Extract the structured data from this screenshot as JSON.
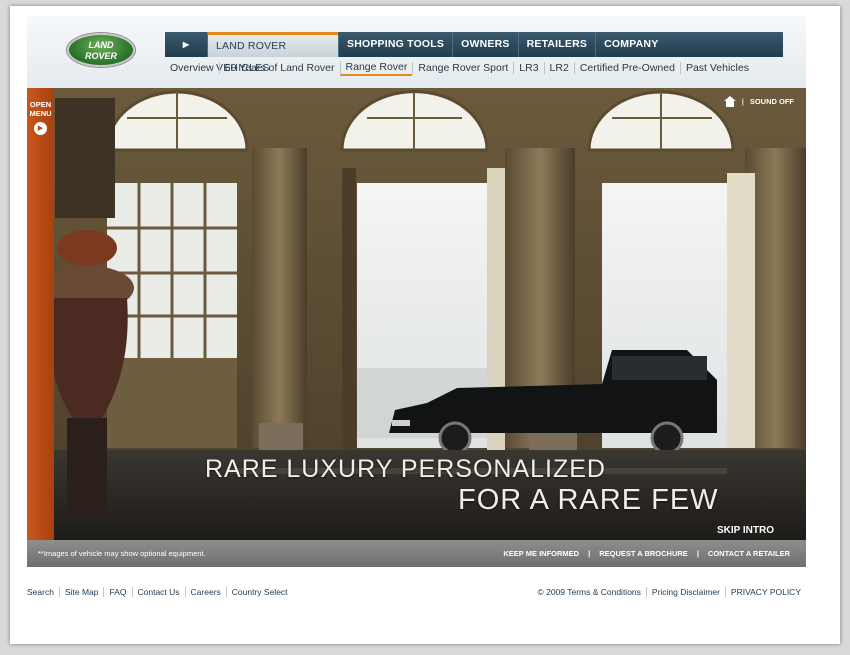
{
  "brand": {
    "logo_line1": "LAND",
    "logo_line2": "ROVER"
  },
  "nav": {
    "arrow": "▶",
    "items": [
      "LAND ROVER VEHICLES",
      "SHOPPING TOOLS",
      "OWNERS",
      "RETAILERS",
      "COMPANY"
    ]
  },
  "subnav": {
    "items": [
      "Overview",
      "60 Years of Land Rover",
      "Range Rover",
      "Range Rover Sport",
      "LR3",
      "LR2",
      "Certified Pre-Owned",
      "Past Vehicles"
    ]
  },
  "hero": {
    "open_menu_line1": "OPEN",
    "open_menu_line2": "MENU",
    "open_menu_arrow": "▶",
    "home_icon": "home-icon",
    "sound_off": "SOUND OFF",
    "separator": "|",
    "tagline1": "RARE LUXURY PERSONALIZED",
    "tagline2": "FOR A RARE FEW",
    "skip_intro": "SKIP INTRO"
  },
  "strip": {
    "note": "**Images of vehicle may show optional equipment.",
    "links": [
      "KEEP ME INFORMED",
      "REQUEST A BROCHURE",
      "CONTACT A RETAILER"
    ],
    "sep": "|"
  },
  "footer": {
    "left": [
      "Search",
      "Site Map",
      "FAQ",
      "Contact Us",
      "Careers",
      "Country Select"
    ],
    "right": [
      "© 2009 Terms & Conditions",
      "Pricing Disclaimer",
      "PRIVACY POLICY"
    ]
  },
  "colors": {
    "nav": "#213d50",
    "accent": "#e08a1e",
    "menu_tab": "#b24a14",
    "logo_green": "#2f7a2e"
  }
}
